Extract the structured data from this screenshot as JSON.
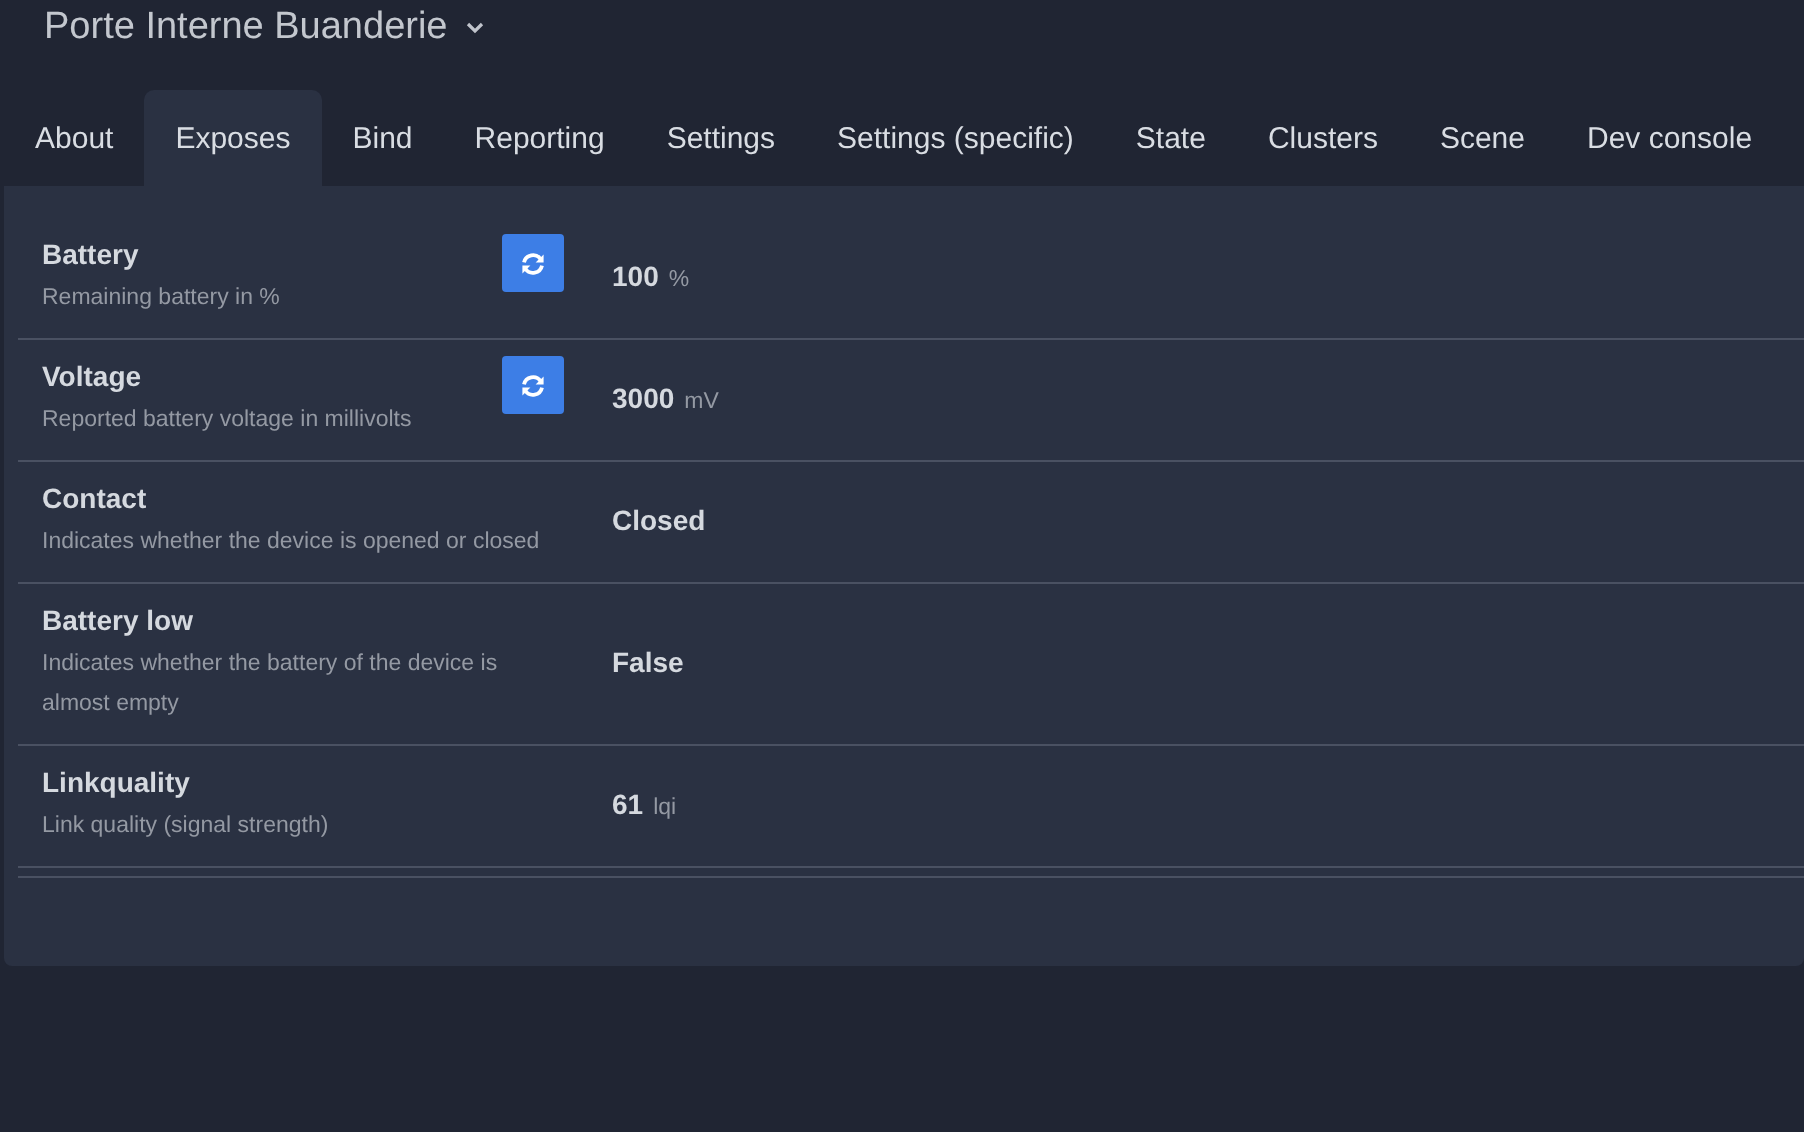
{
  "device": {
    "name": "Porte Interne Buanderie"
  },
  "tabs": [
    {
      "label": "About",
      "selected": false
    },
    {
      "label": "Exposes",
      "selected": true
    },
    {
      "label": "Bind",
      "selected": false
    },
    {
      "label": "Reporting",
      "selected": false
    },
    {
      "label": "Settings",
      "selected": false
    },
    {
      "label": "Settings (specific)",
      "selected": false
    },
    {
      "label": "State",
      "selected": false
    },
    {
      "label": "Clusters",
      "selected": false
    },
    {
      "label": "Scene",
      "selected": false
    },
    {
      "label": "Dev console",
      "selected": false
    }
  ],
  "exposes": [
    {
      "name": "Battery",
      "description": "Remaining battery in %",
      "refreshable": true,
      "value": "100",
      "unit": "%"
    },
    {
      "name": "Voltage",
      "description": "Reported battery voltage in millivolts",
      "refreshable": true,
      "value": "3000",
      "unit": "mV"
    },
    {
      "name": "Contact",
      "description": "Indicates whether the device is opened or closed",
      "refreshable": false,
      "value": "Closed"
    },
    {
      "name": "Battery low",
      "description": "Indicates whether the battery of the device is almost empty",
      "refreshable": false,
      "value": "False"
    },
    {
      "name": "Linkquality",
      "description": "Link quality (signal strength)",
      "refreshable": false,
      "value": "61",
      "unit": "lqi"
    }
  ]
}
